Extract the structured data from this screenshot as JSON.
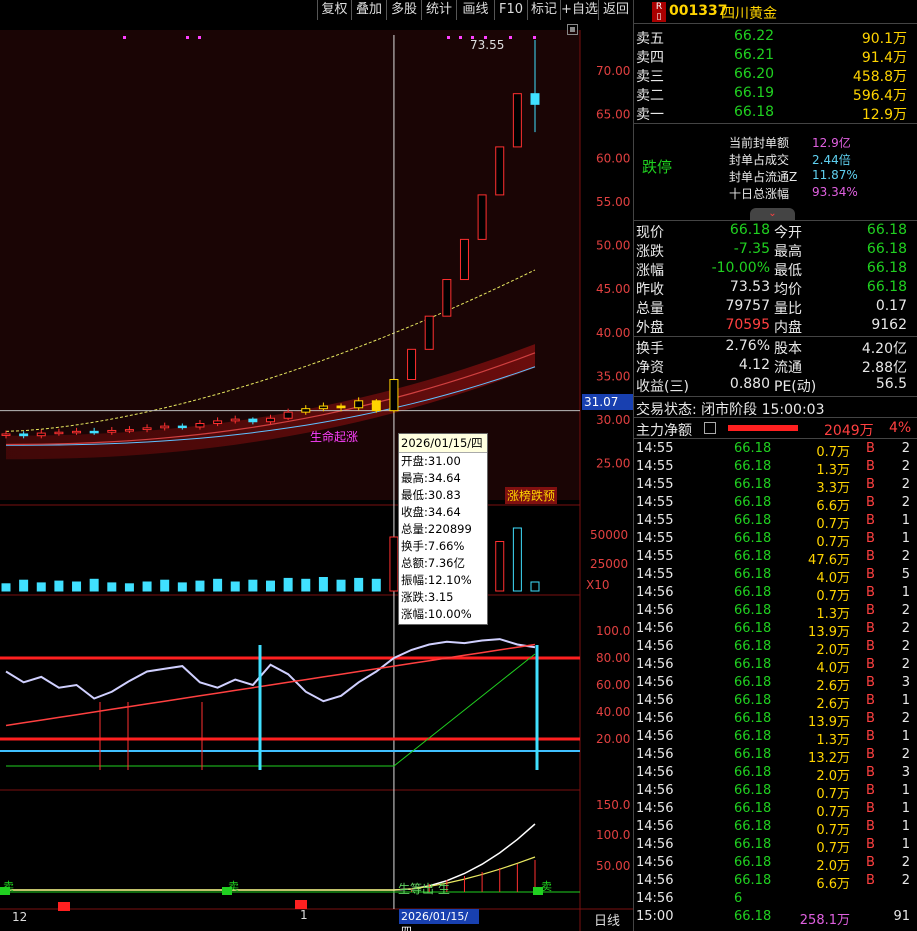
{
  "toolbar": {
    "buttons": [
      "复权",
      "叠加",
      "多股",
      "统计",
      "画线",
      "F10",
      "标记",
      "+自选",
      "返回"
    ]
  },
  "chart": {
    "price_axis": [
      "70.00",
      "65.00",
      "60.00",
      "55.00",
      "50.00",
      "45.00",
      "40.00",
      "35.00",
      "30.00",
      "25.00"
    ],
    "vol_axis": [
      "50000",
      "25000",
      "X10"
    ],
    "kdj_axis": [
      "100.0",
      "80.00",
      "60.00",
      "40.00",
      "20.00"
    ],
    "macd_axis": [
      "150.0",
      "100.0",
      "50.00"
    ],
    "high_label": "73.55",
    "price_line_label": "31.07",
    "signal_label": "生命起涨",
    "badge": "涨榜跌预",
    "bottom_mark": "卖",
    "bottom_mark2": "卖",
    "bottom_mark3": "卖",
    "bottom_text": "生等出 生",
    "x_labels": [
      "12",
      "1"
    ],
    "cursor_date": "2026/01/15/四",
    "period": "日线",
    "tooltip": {
      "date": "2026/01/15/四",
      "rows": [
        "开盘:31.00",
        "最高:34.64",
        "最低:30.83",
        "收盘:34.64",
        "总量:220899",
        "换手:7.66%",
        "总额:7.36亿",
        "振幅:12.10%",
        "涨跌:3.15",
        "涨幅:10.00%"
      ]
    },
    "candles_open": [
      28.3,
      28.4,
      28.2,
      28.5,
      28.6,
      28.7,
      28.6,
      28.8,
      28.9,
      29.1,
      29.3,
      29.2,
      29.6,
      29.9,
      30.1,
      29.8,
      30.2,
      30.9,
      31.3,
      31.6,
      31.4,
      32.2,
      31.07,
      34.64,
      38.1,
      41.9,
      46.1,
      50.7,
      55.8,
      61.3,
      67.4
    ],
    "candles_close": [
      28.4,
      28.2,
      28.5,
      28.6,
      28.7,
      28.6,
      28.8,
      28.9,
      29.1,
      29.3,
      29.2,
      29.6,
      29.9,
      30.1,
      29.8,
      30.2,
      30.9,
      31.3,
      31.6,
      31.4,
      32.2,
      31.07,
      34.64,
      38.1,
      41.9,
      46.1,
      50.7,
      55.8,
      61.3,
      67.4,
      66.18
    ],
    "candles_high": [
      28.8,
      28.7,
      28.9,
      29,
      29.1,
      29.1,
      29.2,
      29.3,
      29.5,
      29.7,
      29.6,
      30,
      30.3,
      30.5,
      30.3,
      30.6,
      31.3,
      31.7,
      32,
      31.9,
      32.6,
      32.4,
      34.64,
      38.1,
      41.9,
      46.1,
      50.7,
      55.8,
      61.3,
      67.4,
      73.55
    ],
    "candles_low": [
      27.9,
      27.9,
      27.9,
      28.2,
      28.3,
      28.3,
      28.3,
      28.5,
      28.6,
      28.8,
      28.9,
      28.9,
      29.3,
      29.6,
      29.5,
      29.5,
      30,
      30.6,
      31,
      31,
      31.1,
      30.83,
      30.83,
      35.2,
      39,
      43,
      47.5,
      52.5,
      57.5,
      63,
      63
    ]
  },
  "quote": {
    "code": "001337",
    "name": "四川黄金",
    "asks": [
      {
        "label": "卖五",
        "price": "66.22",
        "vol": "90.1万"
      },
      {
        "label": "卖四",
        "price": "66.21",
        "vol": "91.4万"
      },
      {
        "label": "卖三",
        "price": "66.20",
        "vol": "458.8万"
      },
      {
        "label": "卖二",
        "price": "66.19",
        "vol": "596.4万"
      },
      {
        "label": "卖一",
        "price": "66.18",
        "vol": "12.9万"
      }
    ],
    "limit_label": "跌停",
    "limit_info": [
      {
        "k": "当前封单额",
        "v": "12.9亿"
      },
      {
        "k": "封单占成交",
        "v": "2.44倍"
      },
      {
        "k": "封单占流通Z",
        "v": "11.87%"
      },
      {
        "k": "十日总涨幅",
        "v": "93.34%"
      }
    ],
    "stats": [
      {
        "k1": "现价",
        "v1": "66.18",
        "k2": "今开",
        "v2": "66.18"
      },
      {
        "k1": "涨跌",
        "v1": "-7.35",
        "k2": "最高",
        "v2": "66.18"
      },
      {
        "k1": "涨幅",
        "v1": "-10.00%",
        "k2": "最低",
        "v2": "66.18"
      },
      {
        "k1": "昨收",
        "v1": "73.53",
        "k2": "均价",
        "v2": "66.18"
      },
      {
        "k1": "总量",
        "v1": "79757",
        "k2": "量比",
        "v2": "0.17"
      },
      {
        "k1": "外盘",
        "v1": "70595",
        "k2": "内盘",
        "v2": "9162"
      }
    ],
    "stats2": [
      {
        "k1": "换手",
        "v1": "2.76%",
        "k2": "股本",
        "v2": "4.20亿"
      },
      {
        "k1": "净资",
        "v1": "4.12",
        "k2": "流通",
        "v2": "2.88亿"
      },
      {
        "k1": "收益(三)",
        "v1": "0.880",
        "k2": "PE(动)",
        "v2": "56.5"
      }
    ],
    "trade_status": "交易状态: 闭市阶段 15:00:03",
    "net_inflow_label": "主力净额",
    "net_inflow_value": "2049万",
    "net_inflow_pct": "4%",
    "ticks": [
      [
        "14:55",
        "66.18",
        "0.7万",
        "B",
        "2"
      ],
      [
        "14:55",
        "66.18",
        "1.3万",
        "B",
        "2"
      ],
      [
        "14:55",
        "66.18",
        "3.3万",
        "B",
        "2"
      ],
      [
        "14:55",
        "66.18",
        "6.6万",
        "B",
        "2"
      ],
      [
        "14:55",
        "66.18",
        "0.7万",
        "B",
        "1"
      ],
      [
        "14:55",
        "66.18",
        "0.7万",
        "B",
        "1"
      ],
      [
        "14:55",
        "66.18",
        "47.6万",
        "B",
        "2"
      ],
      [
        "14:55",
        "66.18",
        "4.0万",
        "B",
        "5"
      ],
      [
        "14:56",
        "66.18",
        "0.7万",
        "B",
        "1"
      ],
      [
        "14:56",
        "66.18",
        "1.3万",
        "B",
        "2"
      ],
      [
        "14:56",
        "66.18",
        "13.9万",
        "B",
        "2"
      ],
      [
        "14:56",
        "66.18",
        "2.0万",
        "B",
        "2"
      ],
      [
        "14:56",
        "66.18",
        "4.0万",
        "B",
        "2"
      ],
      [
        "14:56",
        "66.18",
        "2.6万",
        "B",
        "3"
      ],
      [
        "14:56",
        "66.18",
        "2.6万",
        "B",
        "1"
      ],
      [
        "14:56",
        "66.18",
        "13.9万",
        "B",
        "2"
      ],
      [
        "14:56",
        "66.18",
        "1.3万",
        "B",
        "1"
      ],
      [
        "14:56",
        "66.18",
        "13.2万",
        "B",
        "2"
      ],
      [
        "14:56",
        "66.18",
        "2.0万",
        "B",
        "3"
      ],
      [
        "14:56",
        "66.18",
        "0.7万",
        "B",
        "1"
      ],
      [
        "14:56",
        "66.18",
        "0.7万",
        "B",
        "1"
      ],
      [
        "14:56",
        "66.18",
        "0.7万",
        "B",
        "1"
      ],
      [
        "14:56",
        "66.18",
        "0.7万",
        "B",
        "1"
      ],
      [
        "14:56",
        "66.18",
        "2.0万",
        "B",
        "2"
      ],
      [
        "14:56",
        "66.18",
        "6.6万",
        "B",
        "2"
      ],
      [
        "14:56",
        "6",
        "",
        "",
        ""
      ],
      [
        "15:00",
        "66.18",
        "258.1万",
        "",
        "91"
      ]
    ]
  }
}
